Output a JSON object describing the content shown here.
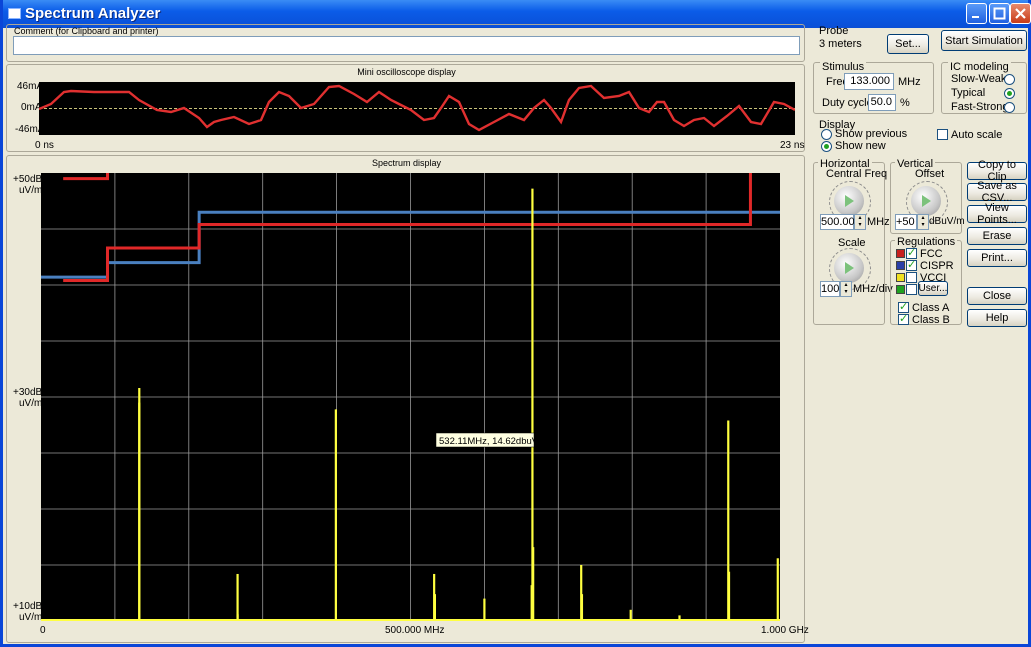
{
  "window": {
    "title": "Spectrum Analyzer"
  },
  "comment": {
    "label": "Comment (for Clipboard and printer)",
    "value": ""
  },
  "probe": {
    "label": "Probe",
    "value": "3 meters",
    "set_button": "Set..."
  },
  "start_button": "Start Simulation",
  "stimulus": {
    "label": "Stimulus",
    "freq_label": "Freq:",
    "freq_value": "133.000",
    "freq_unit": "MHz",
    "duty_label": "Duty cycle:",
    "duty_value": "50.0",
    "duty_unit": "%"
  },
  "ic_modeling": {
    "label": "IC modeling",
    "options": [
      "Slow-Weak",
      "Typical",
      "Fast-Strong"
    ],
    "selected": "Typical"
  },
  "display": {
    "label": "Display",
    "show_previous": "Show previous",
    "show_new": "Show new",
    "auto_scale": "Auto scale",
    "selected": "Show new",
    "auto_scale_checked": false
  },
  "horizontal": {
    "label": "Horizontal",
    "central_label": "Central Freq",
    "central_value": "500.00",
    "central_unit": "MHz",
    "scale_label": "Scale",
    "scale_value": "100",
    "scale_unit": "MHz/div"
  },
  "vertical": {
    "label": "Vertical",
    "offset_label": "Offset",
    "offset_value": "+50",
    "offset_unit": "dBuV/m"
  },
  "regulations": {
    "label": "Regulations",
    "items": [
      {
        "name": "FCC",
        "color": "#c8201e",
        "checked": true
      },
      {
        "name": "CISPR",
        "color": "#2a3fa8",
        "checked": true
      },
      {
        "name": "VCCI",
        "color": "#f0e020",
        "checked": false
      },
      {
        "name": "User...",
        "color": "#20a020",
        "checked": false
      }
    ],
    "class_a": "Class A",
    "class_b": "Class B"
  },
  "side_buttons": [
    "Copy to Clip",
    "Save as CSV...",
    "View Points...",
    "Erase",
    "Print...",
    "Close",
    "Help"
  ],
  "oscilloscope": {
    "title": "Mini oscilloscope display",
    "y_labels": [
      "46mA",
      "0mA",
      "-46mA"
    ],
    "x_start": "0 ns",
    "x_end": "23 ns"
  },
  "spectrum": {
    "title": "Spectrum display",
    "y_labels": [
      {
        "db": "+50dB",
        "unit": "uV/m"
      },
      {
        "db": "+30dB",
        "unit": "uV/m"
      },
      {
        "db": "+10dB",
        "unit": "uV/m"
      }
    ],
    "x_labels": [
      "0",
      "500.000 MHz",
      "1.000 GHz"
    ],
    "tooltip": "532.11MHz, 14.62dbuV/m"
  },
  "colors": {
    "trace": "#ffff40",
    "fcc": "#e02828",
    "cispr": "#4a80c0",
    "scope": "#e03030",
    "grid": "#9a9a9a"
  },
  "chart_data": {
    "type": "bar",
    "xlim": [
      0,
      1000
    ],
    "ylim": [
      10,
      50
    ],
    "x_unit": "MHz",
    "y_unit": "dBuV/m",
    "spikes": [
      {
        "x": 133,
        "y": 30.8
      },
      {
        "x": 133,
        "y": 29.5
      },
      {
        "x": 266,
        "y": 14.2
      },
      {
        "x": 266,
        "y": 10.6
      },
      {
        "x": 399,
        "y": 28.9
      },
      {
        "x": 532,
        "y": 14.2
      },
      {
        "x": 533,
        "y": 12.4
      },
      {
        "x": 600,
        "y": 12.0
      },
      {
        "x": 665,
        "y": 48.6
      },
      {
        "x": 666,
        "y": 16.6
      },
      {
        "x": 664,
        "y": 13.2
      },
      {
        "x": 731,
        "y": 15.0
      },
      {
        "x": 732,
        "y": 12.4
      },
      {
        "x": 798,
        "y": 11.0
      },
      {
        "x": 864,
        "y": 10.5
      },
      {
        "x": 930,
        "y": 27.9
      },
      {
        "x": 931,
        "y": 14.4
      },
      {
        "x": 997,
        "y": 15.6
      }
    ],
    "limits": [
      {
        "points": [
          [
            0,
            40.7
          ],
          [
            90,
            40.7
          ],
          [
            90,
            42.0
          ],
          [
            214,
            42.0
          ],
          [
            214,
            46.5
          ],
          [
            1000,
            46.5
          ]
        ]
      },
      {
        "points": [
          [
            30,
            40.4
          ],
          [
            90,
            40.4
          ],
          [
            90,
            43.3
          ],
          [
            214,
            43.3
          ],
          [
            214,
            45.4
          ],
          [
            960,
            45.4
          ],
          [
            960,
            50
          ]
        ]
      },
      {
        "points": [
          [
            30,
            49.5
          ],
          [
            90,
            49.5
          ],
          [
            90,
            50
          ]
        ]
      }
    ]
  }
}
